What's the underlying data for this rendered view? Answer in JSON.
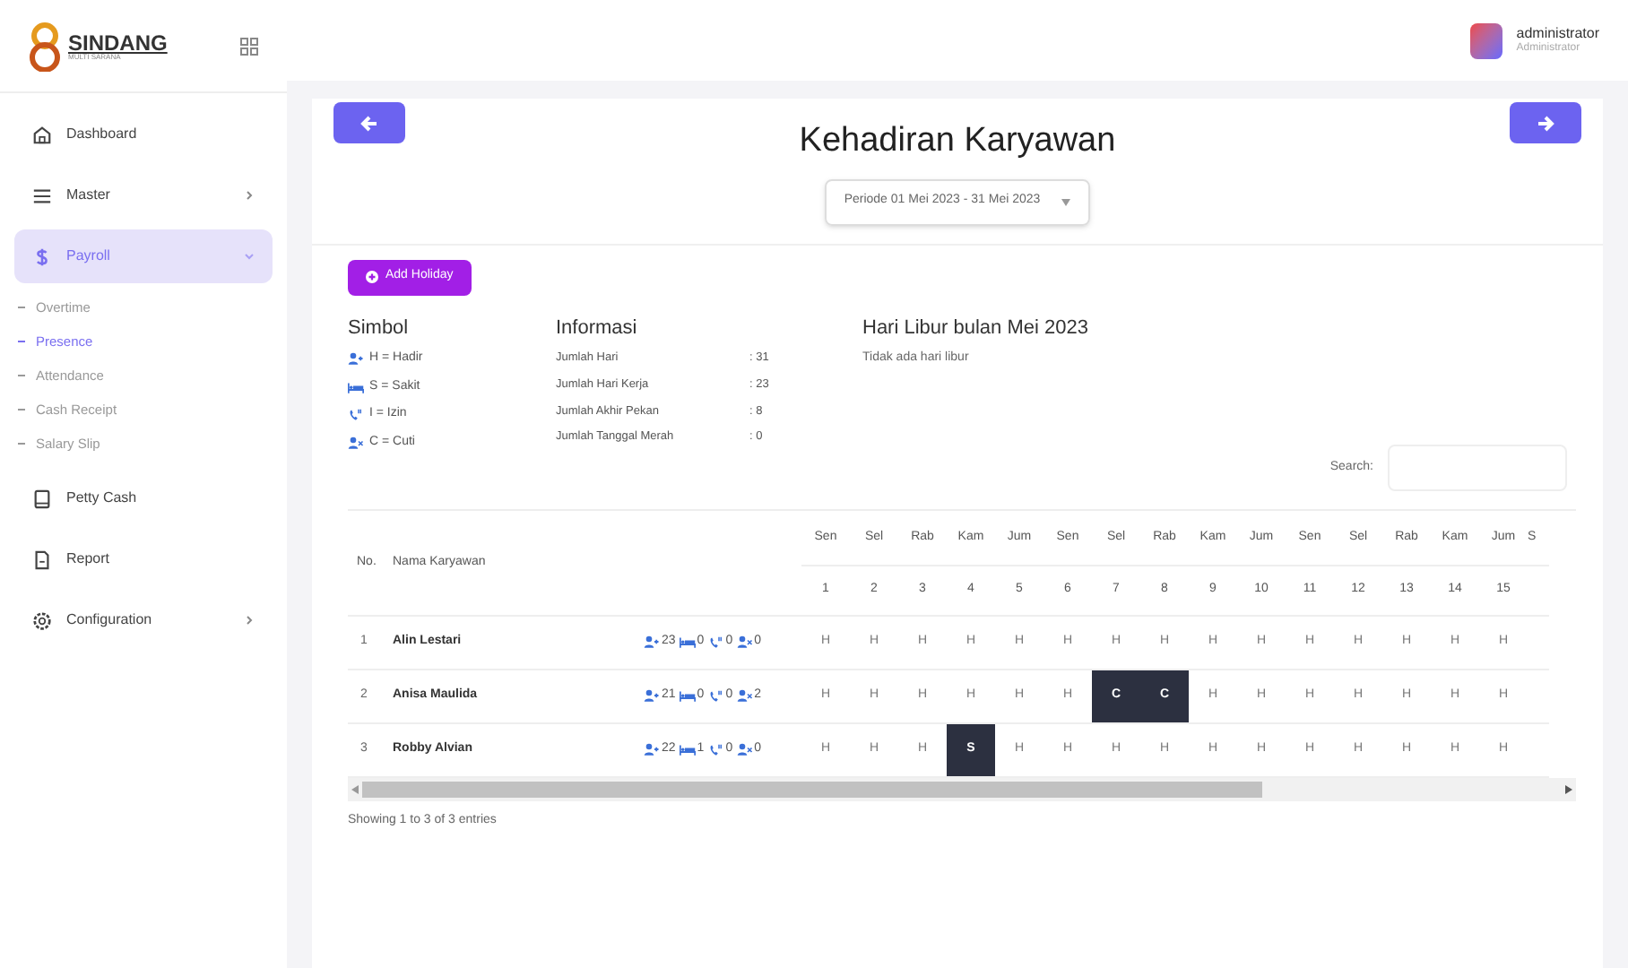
{
  "brand": {
    "name": "SINDANG",
    "tagline": "MULTI SARANA"
  },
  "user": {
    "name": "administrator",
    "role": "Administrator"
  },
  "sidebar": {
    "items": [
      {
        "kind": "home",
        "label": "Dashboard",
        "selected": false
      },
      {
        "kind": "list",
        "label": "Master",
        "selected": false,
        "expanded": false
      },
      {
        "kind": "dollar",
        "label": "Payroll",
        "selected": true,
        "expanded": true,
        "children": [
          {
            "label": "Overtime",
            "selected": false
          },
          {
            "label": "Presence",
            "selected": true
          },
          {
            "label": "Attendance",
            "selected": false
          },
          {
            "label": "Cash Receipt",
            "selected": false
          },
          {
            "label": "Salary Slip",
            "selected": false
          }
        ]
      },
      {
        "kind": "tablet",
        "label": "Petty Cash",
        "selected": false
      },
      {
        "kind": "file",
        "label": "Report",
        "selected": false
      },
      {
        "kind": "gear",
        "label": "Configuration",
        "selected": false,
        "expanded": false
      }
    ]
  },
  "page": {
    "title": "Kehadiran Karyawan",
    "period": "Periode 01 Mei 2023 - 31 Mei 2023",
    "add_button": "Add Holiday"
  },
  "simbol": {
    "title": "Simbol",
    "items": [
      {
        "kind": "hadir",
        "text": "H = Hadir"
      },
      {
        "kind": "sakit",
        "text": "S = Sakit"
      },
      {
        "kind": "izin",
        "text": "I = Izin"
      },
      {
        "kind": "cuti",
        "text": "C = Cuti"
      }
    ]
  },
  "informasi": {
    "title": "Informasi",
    "rows": [
      {
        "label": "Jumlah Hari",
        "value": ": 31"
      },
      {
        "label": "Jumlah Hari Kerja",
        "value": ": 23"
      },
      {
        "label": "Jumlah Akhir Pekan",
        "value": ": 8"
      },
      {
        "label": "Jumlah Tanggal Merah",
        "value": ": 0"
      }
    ]
  },
  "holidays": {
    "title": "Hari Libur bulan Mei 2023",
    "text": "Tidak ada hari libur"
  },
  "search": {
    "label": "Search:"
  },
  "table": {
    "col_no": "No.",
    "col_name": "Nama Karyawan",
    "days": [
      {
        "day": "Sen",
        "date": "1"
      },
      {
        "day": "Sel",
        "date": "2"
      },
      {
        "day": "Rab",
        "date": "3"
      },
      {
        "day": "Kam",
        "date": "4"
      },
      {
        "day": "Jum",
        "date": "5"
      },
      {
        "day": "Sen",
        "date": "6"
      },
      {
        "day": "Sel",
        "date": "7"
      },
      {
        "day": "Rab",
        "date": "8"
      },
      {
        "day": "Kam",
        "date": "9"
      },
      {
        "day": "Jum",
        "date": "10"
      },
      {
        "day": "Sen",
        "date": "11"
      },
      {
        "day": "Sel",
        "date": "12"
      },
      {
        "day": "Rab",
        "date": "13"
      },
      {
        "day": "Kam",
        "date": "14"
      },
      {
        "day": "Jum",
        "date": "15"
      },
      {
        "day": "S"
      }
    ],
    "rows": [
      {
        "no": "1",
        "name": "Alin Lestari",
        "summary": [
          {
            "kind": "hadir",
            "count": "23"
          },
          {
            "kind": "sakit",
            "count": "0"
          },
          {
            "kind": "izin",
            "count": "0"
          },
          {
            "kind": "cuti",
            "count": "0"
          }
        ],
        "cells": [
          {
            "text": "H",
            "highlight": false
          },
          {
            "text": "H",
            "highlight": false
          },
          {
            "text": "H",
            "highlight": false
          },
          {
            "text": "H",
            "highlight": false
          },
          {
            "text": "H",
            "highlight": false
          },
          {
            "text": "H",
            "highlight": false
          },
          {
            "text": "H",
            "highlight": false
          },
          {
            "text": "H",
            "highlight": false
          },
          {
            "text": "H",
            "highlight": false
          },
          {
            "text": "H",
            "highlight": false
          },
          {
            "text": "H",
            "highlight": false
          },
          {
            "text": "H",
            "highlight": false
          },
          {
            "text": "H",
            "highlight": false
          },
          {
            "text": "H",
            "highlight": false
          },
          {
            "text": "H",
            "highlight": false
          }
        ]
      },
      {
        "no": "2",
        "name": "Anisa Maulida",
        "summary": [
          {
            "kind": "hadir",
            "count": "21"
          },
          {
            "kind": "sakit",
            "count": "0"
          },
          {
            "kind": "izin",
            "count": "0"
          },
          {
            "kind": "cuti",
            "count": "2"
          }
        ],
        "cells": [
          {
            "text": "H",
            "highlight": false
          },
          {
            "text": "H",
            "highlight": false
          },
          {
            "text": "H",
            "highlight": false
          },
          {
            "text": "H",
            "highlight": false
          },
          {
            "text": "H",
            "highlight": false
          },
          {
            "text": "H",
            "highlight": false
          },
          {
            "text": "C",
            "highlight": true
          },
          {
            "text": "C",
            "highlight": true
          },
          {
            "text": "H",
            "highlight": false
          },
          {
            "text": "H",
            "highlight": false
          },
          {
            "text": "H",
            "highlight": false
          },
          {
            "text": "H",
            "highlight": false
          },
          {
            "text": "H",
            "highlight": false
          },
          {
            "text": "H",
            "highlight": false
          },
          {
            "text": "H",
            "highlight": false
          }
        ]
      },
      {
        "no": "3",
        "name": "Robby Alvian",
        "summary": [
          {
            "kind": "hadir",
            "count": "22"
          },
          {
            "kind": "sakit",
            "count": "1"
          },
          {
            "kind": "izin",
            "count": "0"
          },
          {
            "kind": "cuti",
            "count": "0"
          }
        ],
        "cells": [
          {
            "text": "H",
            "highlight": false
          },
          {
            "text": "H",
            "highlight": false
          },
          {
            "text": "H",
            "highlight": false
          },
          {
            "text": "S",
            "highlight": true
          },
          {
            "text": "H",
            "highlight": false
          },
          {
            "text": "H",
            "highlight": false
          },
          {
            "text": "H",
            "highlight": false
          },
          {
            "text": "H",
            "highlight": false
          },
          {
            "text": "H",
            "highlight": false
          },
          {
            "text": "H",
            "highlight": false
          },
          {
            "text": "H",
            "highlight": false
          },
          {
            "text": "H",
            "highlight": false
          },
          {
            "text": "H",
            "highlight": false
          },
          {
            "text": "H",
            "highlight": false
          },
          {
            "text": "H",
            "highlight": false
          }
        ]
      }
    ]
  },
  "footer": {
    "info": "Showing 1 to 3 of 3 entries"
  }
}
